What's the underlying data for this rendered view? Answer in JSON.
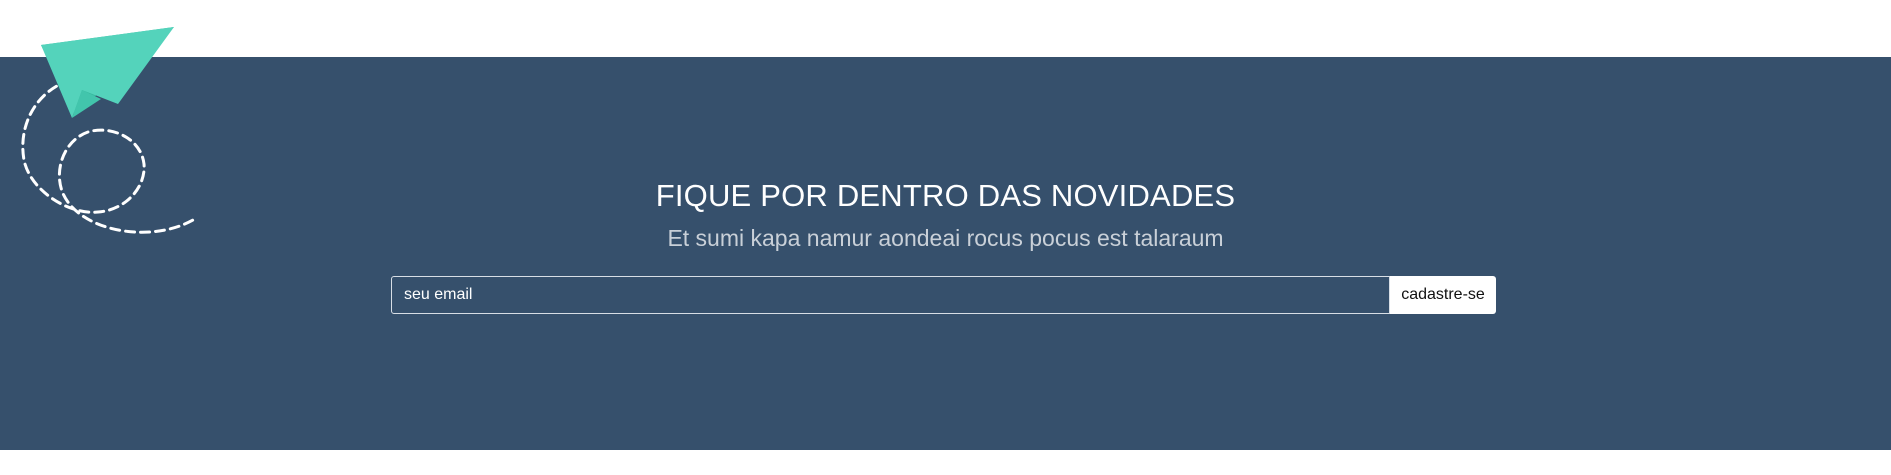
{
  "newsletter": {
    "title": "FIQUE POR DENTRO DAS NOVIDADES",
    "subtitle": "Et sumi kapa namur aondeai rocus pocus est talaraum",
    "email_placeholder": "seu email",
    "button_label": "cadastre-se",
    "decoration_icon": "paper-plane-icon"
  },
  "colors": {
    "background": "#ffffff",
    "newsletter_background": "#36506c",
    "plane_main": "#54d3bb",
    "plane_shadow": "#37b99e",
    "dashed_path": "#ffffff",
    "subtitle": "#c9d0d8"
  }
}
